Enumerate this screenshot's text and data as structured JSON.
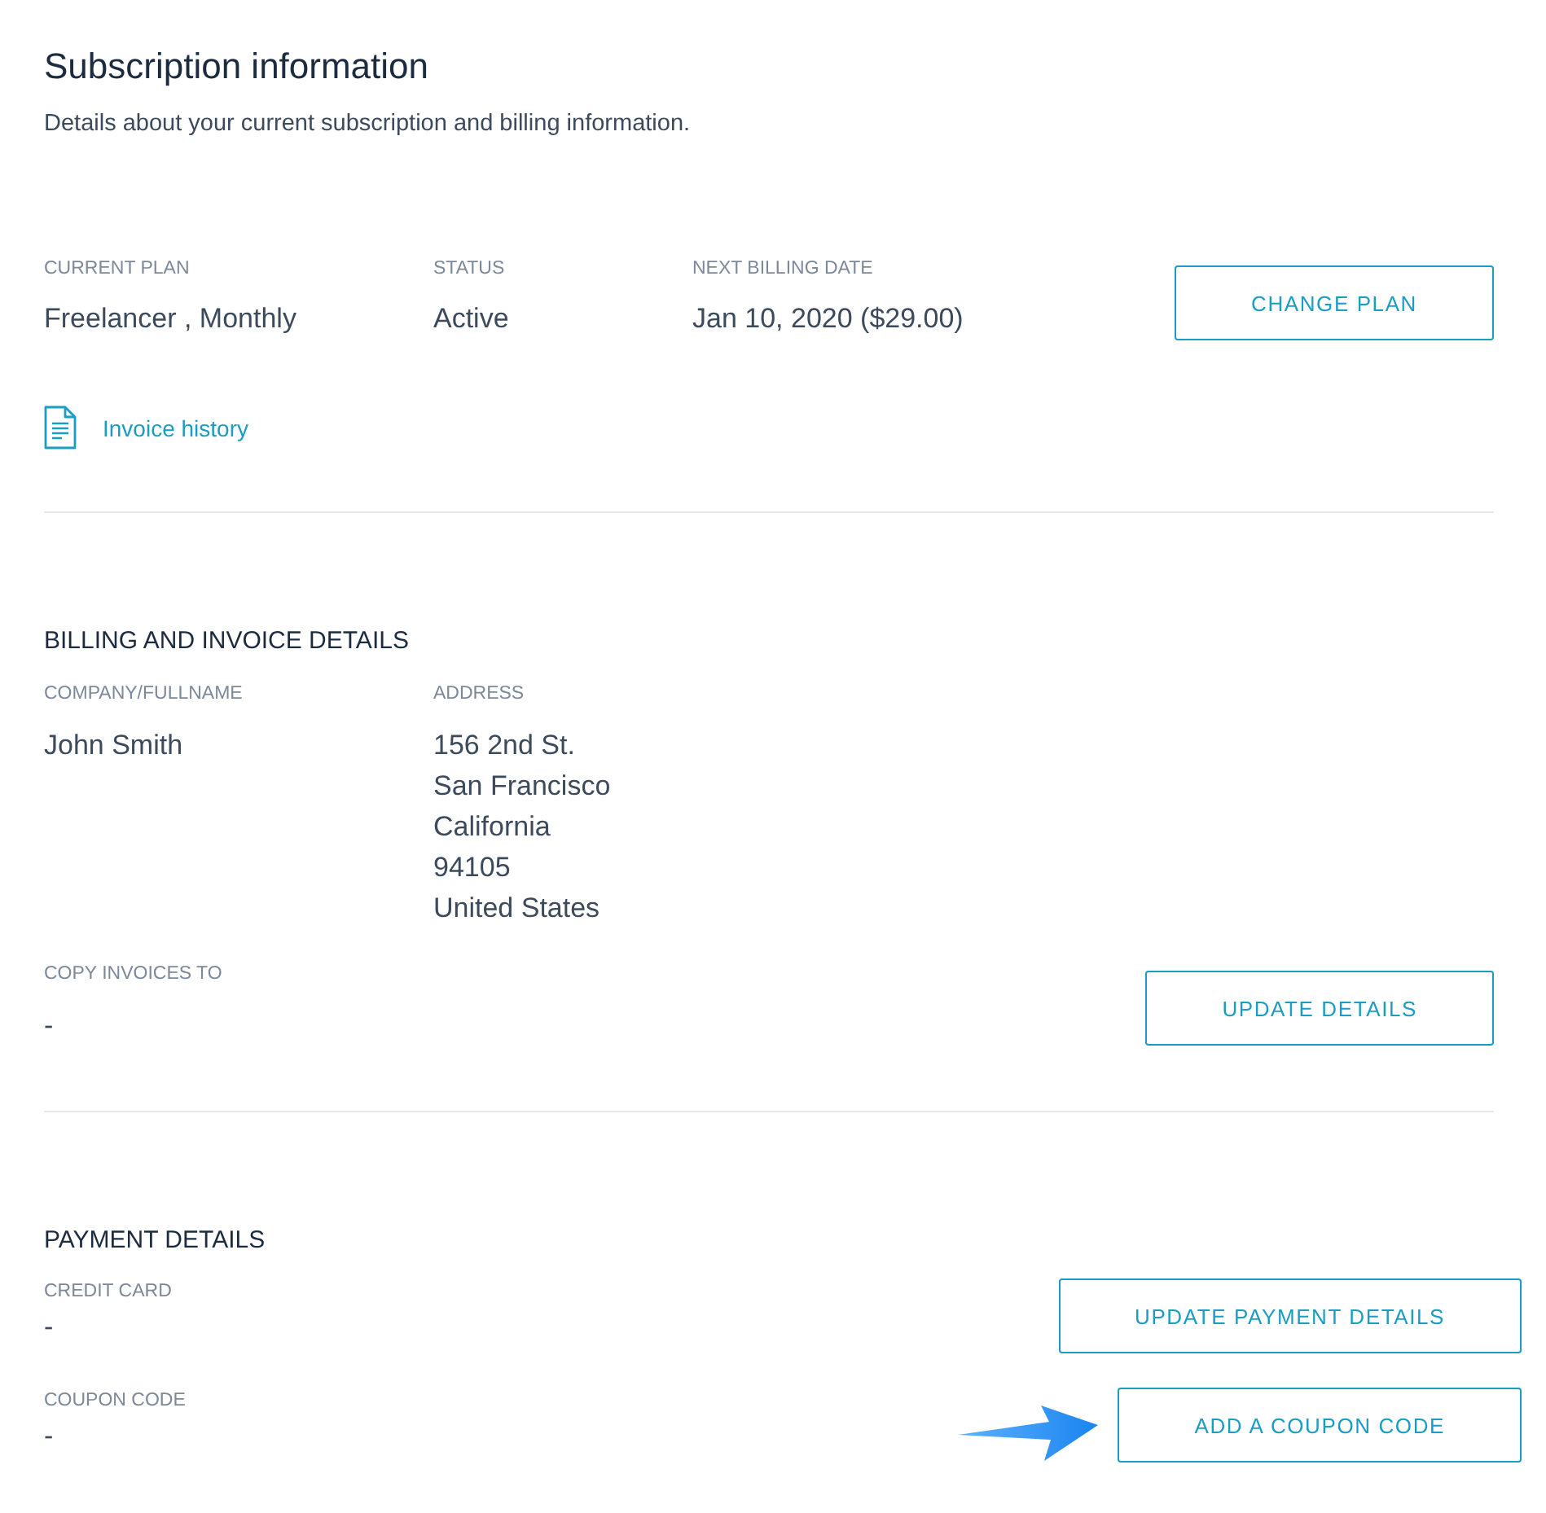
{
  "header": {
    "title": "Subscription information",
    "subtitle": "Details about your current subscription and billing information."
  },
  "plan_summary": {
    "fields": [
      {
        "label": "CURRENT PLAN",
        "value": "Freelancer , Monthly"
      },
      {
        "label": "STATUS",
        "value": "Active"
      },
      {
        "label": "NEXT BILLING DATE",
        "value": "Jan 10, 2020 ($29.00)"
      }
    ],
    "button": "CHANGE PLAN",
    "invoice_link": "Invoice history"
  },
  "billing": {
    "heading": "BILLING AND INVOICE DETAILS",
    "fields": [
      {
        "label": "COMPANY/FULLNAME",
        "lines": [
          "John Smith"
        ]
      },
      {
        "label": "ADDRESS",
        "lines": [
          "156 2nd St.",
          "San Francisco",
          "California",
          "94105",
          "United States"
        ]
      }
    ],
    "copy_invoices": {
      "label": "COPY INVOICES TO",
      "value": "-"
    },
    "button": "UPDATE DETAILS"
  },
  "payment": {
    "heading": "PAYMENT DETAILS",
    "rows": [
      {
        "label": "CREDIT CARD",
        "value": "-",
        "button": "UPDATE PAYMENT DETAILS",
        "pointer": false
      },
      {
        "label": "COUPON CODE",
        "value": "-",
        "button": "ADD A COUPON CODE",
        "pointer": true
      }
    ]
  }
}
